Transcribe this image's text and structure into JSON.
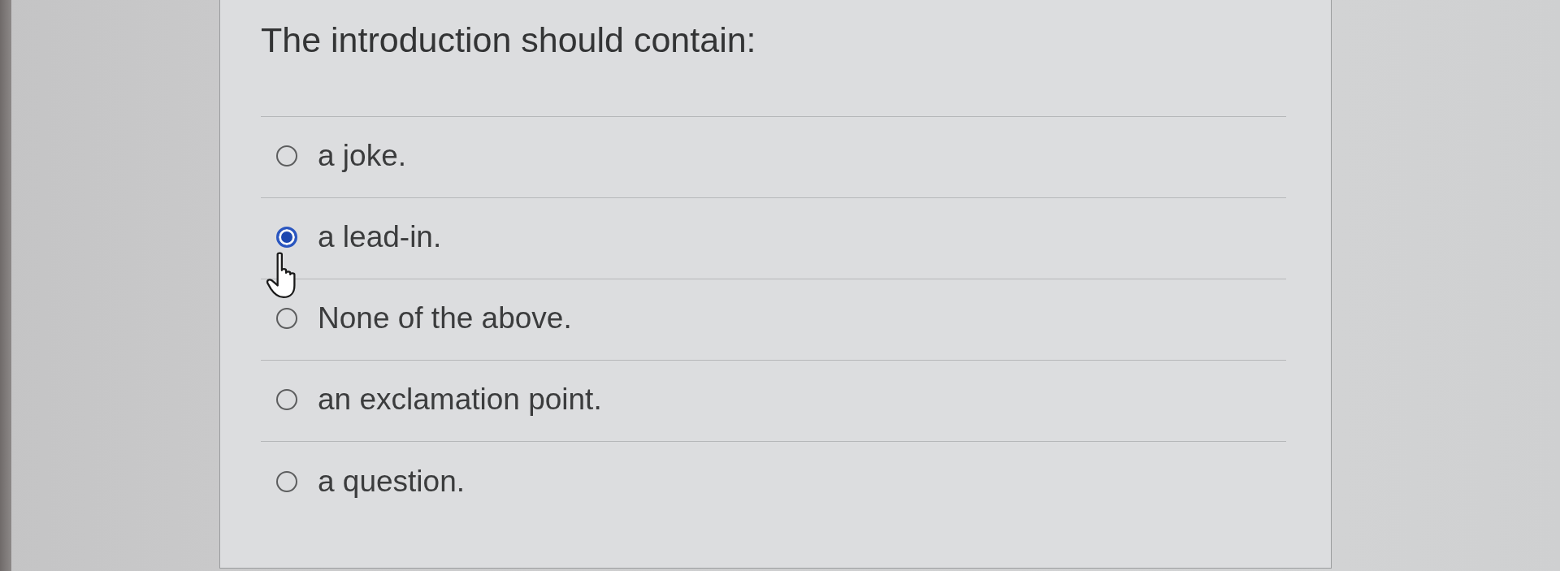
{
  "question": {
    "text": "The introduction should contain:"
  },
  "options": [
    {
      "label": "a joke.",
      "selected": false
    },
    {
      "label": "a lead-in.",
      "selected": true
    },
    {
      "label": "None of the above.",
      "selected": false
    },
    {
      "label": "an exclamation point.",
      "selected": false
    },
    {
      "label": "a question.",
      "selected": false
    }
  ]
}
